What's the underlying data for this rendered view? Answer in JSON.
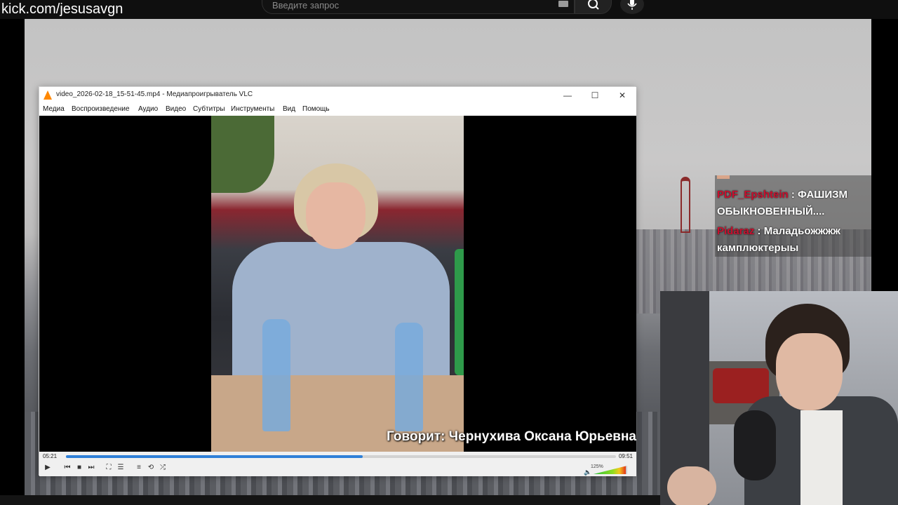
{
  "browser": {
    "channel_url": "kick.com/jesusavgn",
    "search": {
      "placeholder": "Введите запрос"
    },
    "icons": [
      "keyboard-icon",
      "search-icon",
      "microphone-icon"
    ]
  },
  "chat": {
    "cut_line": {
      "user": "",
      "text": ""
    },
    "messages": [
      {
        "user": "PDF_Epshtein",
        "text": ": ФАШИЗМ ОБЫКНОВЕННЫЙ...."
      },
      {
        "user": "Pidaraz",
        "text": ": Маладьожжжж камплюктерыы"
      }
    ],
    "user_color": "#c8102e"
  },
  "vlc": {
    "title": "video_2026-02-18_15-51-45.mp4 - Медиапроигрыватель VLC",
    "window_buttons": {
      "minimize": "—",
      "maximize": "☐",
      "close": "✕"
    },
    "menu": [
      "Медиа",
      "Воспроизведение",
      "Аудио",
      "Видео",
      "Субтитры",
      "Инструменты",
      "Вид",
      "Помощь"
    ],
    "caption": "Говорит: Чернухива Оксана Юрьевна",
    "time_elapsed": "05:21",
    "time_total": "09:51",
    "progress_fraction": 0.54,
    "volume_label": "125%",
    "volume_fraction": 0.95,
    "accent_color": "#2f80d8",
    "controls": {
      "play": "▶",
      "prev": "⏮",
      "stop": "■",
      "next": "⏭",
      "fullscreen": "⛶",
      "extended": "☰",
      "playlist": "≡",
      "loop": "⟲",
      "shuffle": "⤮",
      "speaker": "🔈"
    }
  }
}
